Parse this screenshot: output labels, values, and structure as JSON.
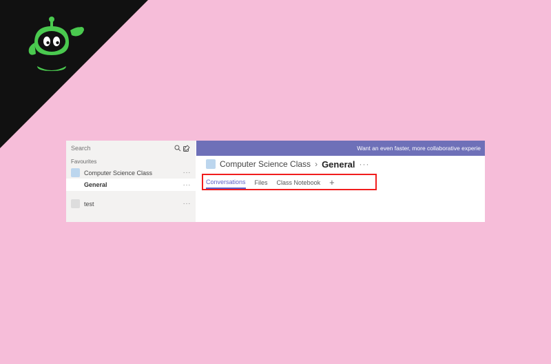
{
  "logo": {
    "name": "robot-logo",
    "color": "#4ac94f"
  },
  "sidebar": {
    "search_placeholder": "Search",
    "favourites_label": "Favourites",
    "teams": [
      {
        "name": "Computer Science Class",
        "avatar": "blue",
        "channels": [
          {
            "name": "General",
            "active": true
          }
        ]
      },
      {
        "name": "test",
        "avatar": "grey",
        "channels": []
      }
    ]
  },
  "banner": {
    "text": "Want an even faster, more collaborative experie"
  },
  "breadcrumb": {
    "team": "Computer Science Class",
    "channel": "General"
  },
  "tabs": {
    "items": [
      {
        "label": "Conversations",
        "active": true
      },
      {
        "label": "Files",
        "active": false
      },
      {
        "label": "Class Notebook",
        "active": false
      }
    ],
    "add_label": "+"
  },
  "colors": {
    "page_bg": "#f6bdd9",
    "banner_bg": "#6e70b8",
    "accent": "#5b5fc7",
    "highlight_box": "#f11c1c"
  }
}
